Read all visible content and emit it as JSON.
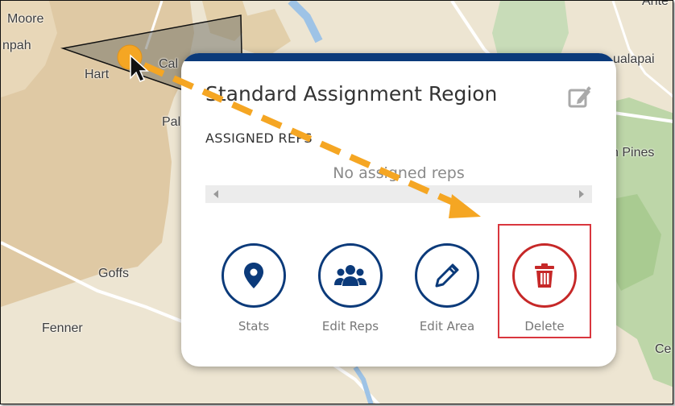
{
  "map": {
    "labels": [
      "Moore",
      "npah",
      "Hart",
      "Cal",
      "Pal",
      "Goffs",
      "Fenner",
      "Ante",
      "ualapai",
      "n Pines",
      "Ce"
    ]
  },
  "card": {
    "title": "Standard Assignment Region",
    "assigned_reps_label": "ASSIGNED REPS",
    "empty_message": "No assigned reps",
    "accent_color": "#0b3a7a",
    "actions": [
      {
        "label": "Stats",
        "icon": "map-pin-icon"
      },
      {
        "label": "Edit Reps",
        "icon": "users-group-icon"
      },
      {
        "label": "Edit Area",
        "icon": "pencil-icon"
      },
      {
        "label": "Delete",
        "icon": "trash-icon"
      }
    ],
    "delete_color": "#c62828"
  },
  "annotation": {
    "arrow_color": "#f5a623",
    "highlight_color": "#d9363e"
  }
}
